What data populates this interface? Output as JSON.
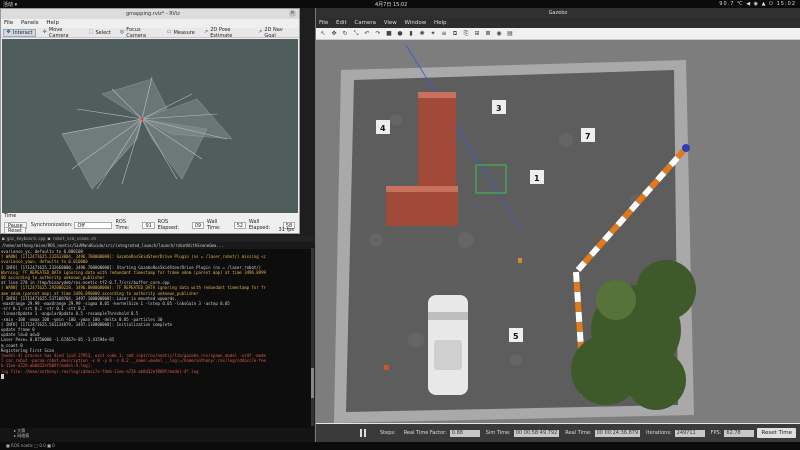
{
  "sysbar": {
    "left": "活动 ▾",
    "center": "4月7日 15:02",
    "right": "90.7 ℃ ◀ ◉ ▲ ⏻ 15:02"
  },
  "rviz": {
    "title": "gmapping.rviz* - RViz",
    "menu": [
      "File",
      "Panels",
      "Help"
    ],
    "tools": [
      {
        "icon": "interact-icon",
        "glyph": "✥",
        "label": "Interact"
      },
      {
        "icon": "move-camera-icon",
        "glyph": "✢",
        "label": "Move Camera"
      },
      {
        "icon": "select-icon",
        "glyph": "⬚",
        "label": "Select"
      },
      {
        "icon": "focus-camera-icon",
        "glyph": "◎",
        "label": "Focus Camera"
      },
      {
        "icon": "measure-icon",
        "glyph": "▭",
        "label": "Measure"
      },
      {
        "icon": "pose-estimate-icon",
        "glyph": "↗",
        "label": "2D Pose Estimate"
      },
      {
        "icon": "nav-goal-icon",
        "glyph": "↗",
        "label": "2D Nav Goal"
      }
    ],
    "time": {
      "panel_label": "Time",
      "pause_label": "Pause",
      "sync_label": "Synchronization:",
      "sync_value": "Off",
      "ros_time_label": "ROS Time:",
      "ros_time": "91",
      "ros_elapsed_label": "ROS Elapsed:",
      "ros_elapsed": "09",
      "wall_time_label": "Wall Time:",
      "wall_time": "52",
      "wall_elapsed_label": "Wall Elapsed:",
      "wall_elapsed": "58",
      "reset_label": "Reset",
      "fps": "31 fps"
    }
  },
  "terminal": {
    "tabs": "■ gaz_keyboard.cpp  ■ robot_vcm_scene.sh",
    "path": "/home/anthony/mine/ROS_noetic/SLAMandGuide/src/integrated_launch/launch/robotWithSceneGma...",
    "lines": [
      {
        "cls": "info",
        "text": "ovariance_yx, defaults to 0.000100"
      },
      {
        "cls": "warn",
        "text": "[ WARN] [1712471625.232613004, 3496.700000000]: GazeboRosSkidSteerDrive Plugin (ns = /laser_robot/) missing <c"
      },
      {
        "cls": "warn",
        "text": "ovariance_yaw>, defaults to 0.010000"
      },
      {
        "cls": "info",
        "text": "[ INFO] [1712471625.232668000, 3496.700000000]: Starting GazeboRosSkidSteerDrive Plugin (ns = /laser_robot/)"
      },
      {
        "cls": "warn",
        "text": "Warning: TF_REPEATED_DATA ignoring data with redundant timestamp for frame odom (parent map) at time 3496.8999"
      },
      {
        "cls": "warn",
        "text": "00 according to authority unknown_publisher"
      },
      {
        "cls": "info",
        "text": "        at line 278 in /tmp/binarydeb/ros-noetic-tf2-0.7.7/src/buffer_core.cpp"
      },
      {
        "cls": "warn",
        "text": "[ WARN] [1712471625.292080228, 3496.800000000]: TF_REPEATED_DATA ignoring data with redundant timestamp for fr"
      },
      {
        "cls": "warn",
        "text": "ame odom (parent map) at time 3496.890000 according to authority unknown_publisher"
      },
      {
        "cls": "info",
        "text": "[ INFO] [1712471625.537108784, 3497.100000000]: Laser is mounted upwards."
      },
      {
        "cls": "info",
        "text": " -maxUrange 29.99 -maxUrange 29.99 -sigma     0.05 -kernelSize 1 -lstep 0.05 -lobsGain 3 -astep 0.05"
      },
      {
        "cls": "info",
        "text": " -srr 0.1 -srt 0.2 -str 0.1 -stt 0.2"
      },
      {
        "cls": "info",
        "text": " -linearUpdate 1 -angularUpdate 0.5 -resampleThreshold 0.5"
      },
      {
        "cls": "info",
        "text": " -xmin -100 -xmax 100 -ymin -100 -ymax 100 -delta 0.05 -particles 30"
      },
      {
        "cls": "info",
        "text": "[ INFO] [1712471625.561134879, 3497.110000000]: Initialization complete"
      },
      {
        "cls": "info",
        "text": "update frame 0"
      },
      {
        "cls": "info",
        "text": "update ld=0 ad=0"
      },
      {
        "cls": "info",
        "text": "Laser Pose= 0.0750000 -1.67467e-05 -3.41594e-05"
      },
      {
        "cls": "info",
        "text": "m_count 0"
      },
      {
        "cls": "info",
        "text": "Registering First Scan"
      },
      {
        "cls": "red",
        "text": "[model-4] process has died [pid 27953, exit code 1, cmd /opt/ros/noetic/lib/gazebo_ros/spawn_model -urdf -mode"
      },
      {
        "cls": "red",
        "text": "l car_robot -param robot_description -x 0 -y 0 -z 0.2 __name:=model __log:=/home/anthony/.ros/log/cddacc7e-fee"
      },
      {
        "cls": "red",
        "text": "b-11ee-a72b-ab8d32ef009f/model-4.log]."
      },
      {
        "cls": "red",
        "text": "log file: /home/anthony/.ros/log/cddacc7e-f4eb-11ee-a72b-ab8d32ef009f/model-4*.log"
      }
    ]
  },
  "treepanel": [
    "▸ 大赛",
    "▸ 网络赛"
  ],
  "statusbar": "■ ROS noetic  □ 0.0  ■ 0",
  "gazebo": {
    "title": "Gazebo",
    "menu": [
      "File",
      "Edit",
      "Camera",
      "View",
      "Window",
      "Help"
    ],
    "toolbar_icons": [
      "select-arrow-icon",
      "translate-icon",
      "rotate-icon",
      "scale-icon",
      "undo-icon",
      "redo-icon",
      "box-icon",
      "sphere-icon",
      "cylinder-icon",
      "point-light-icon",
      "spot-light-icon",
      "directional-light-icon",
      "copy-icon",
      "paste-icon",
      "align-icon",
      "snap-icon",
      "screenshot-icon",
      "log-icon"
    ],
    "toolbar_glyphs": [
      "↖",
      "✥",
      "↻",
      "⤡",
      "↶",
      "↷",
      "■",
      "●",
      "▮",
      "✺",
      "✦",
      "≡",
      "⧉",
      "⎘",
      "⊞",
      "⊠",
      "◉",
      "▤"
    ],
    "bottom": {
      "steps_label": "Steps:",
      "rtf_label": "Real Time Factor:",
      "rtf": "0.88",
      "sim_time_label": "Sim Time:",
      "sim_time": "00 00:58:49.792",
      "real_time_label": "Real Time:",
      "real_time": "00 00:24:36.879",
      "iter_label": "Iterations:",
      "iter": "249711",
      "fps_label": "FPS:",
      "fps": "62.78",
      "reset_label": "Reset Time"
    },
    "markers": [
      "3",
      "4",
      "7",
      "1",
      "5"
    ]
  }
}
